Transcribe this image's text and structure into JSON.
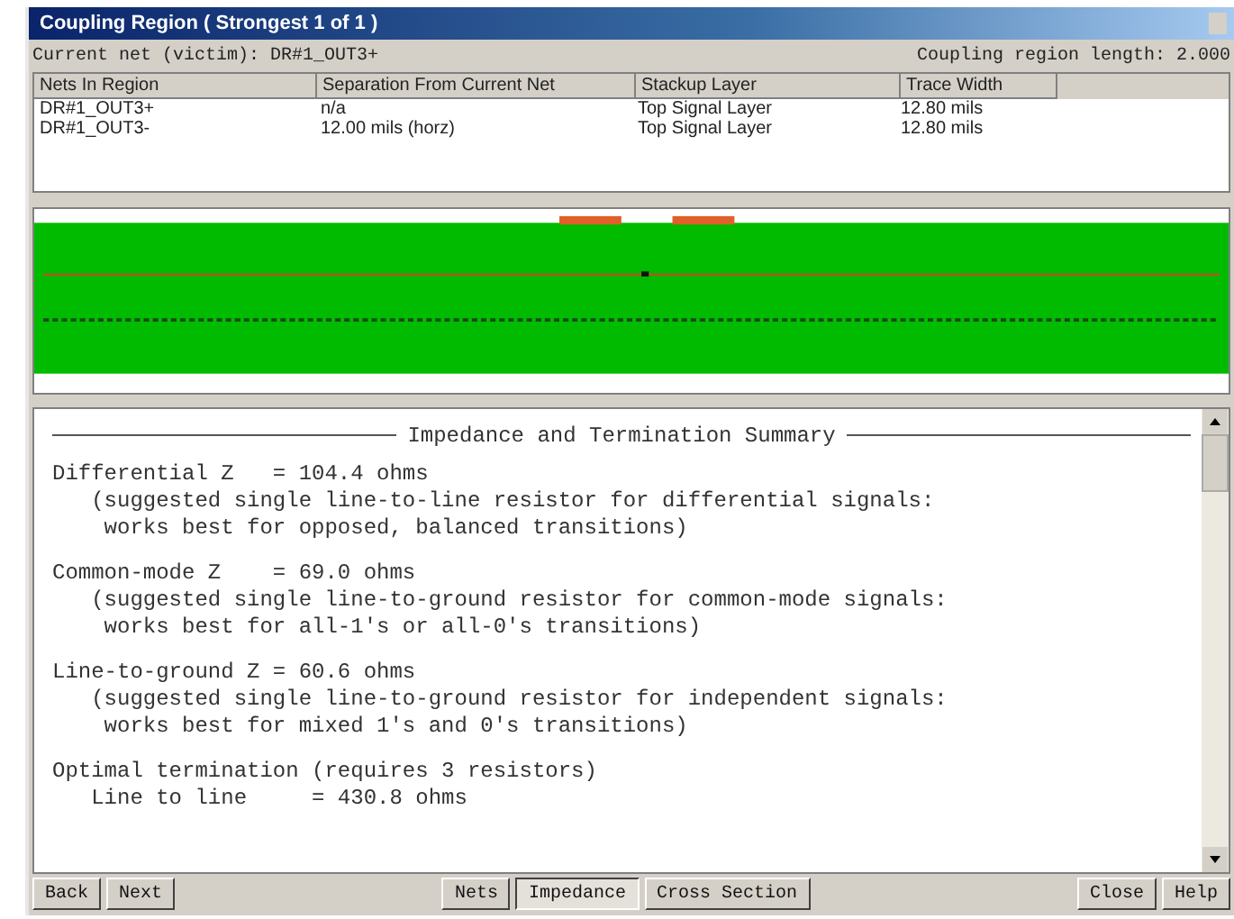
{
  "window": {
    "title": "Coupling Region ( Strongest 1 of 1 )"
  },
  "info": {
    "current_net": "Current net (victim): DR#1_OUT3+",
    "region_length": "Coupling region length: 2.000"
  },
  "table": {
    "columns": [
      "Nets In Region",
      "Separation From Current Net",
      "Stackup Layer",
      "Trace Width"
    ],
    "rows": [
      [
        "DR#1_OUT3+",
        "n/a",
        "Top Signal Layer",
        "12.80 mils"
      ],
      [
        "DR#1_OUT3-",
        "12.00 mils (horz)",
        "Top Signal Layer",
        "12.80 mils"
      ]
    ]
  },
  "summary": {
    "heading": "Impedance and Termination Summary",
    "paragraphs": [
      [
        "Differential Z   = 104.4 ohms",
        "   (suggested single line-to-line resistor for differential signals:",
        "    works best for opposed, balanced transitions)"
      ],
      [
        "Common-mode Z    = 69.0 ohms",
        "   (suggested single line-to-ground resistor for common-mode signals:",
        "    works best for all-1's or all-0's transitions)"
      ],
      [
        "Line-to-ground Z = 60.6 ohms",
        "   (suggested single line-to-ground resistor for independent signals:",
        "    works best for mixed 1's and 0's transitions)"
      ],
      [
        "Optimal termination (requires 3 resistors)",
        "   Line to line     = 430.8 ohms"
      ]
    ]
  },
  "nav_buttons": [
    "Back",
    "Next"
  ],
  "tabs": [
    {
      "label": "Nets",
      "selected": false
    },
    {
      "label": "Impedance",
      "selected": true
    },
    {
      "label": "Cross Section",
      "selected": false
    }
  ],
  "buttons": [
    "Close",
    "Help"
  ]
}
